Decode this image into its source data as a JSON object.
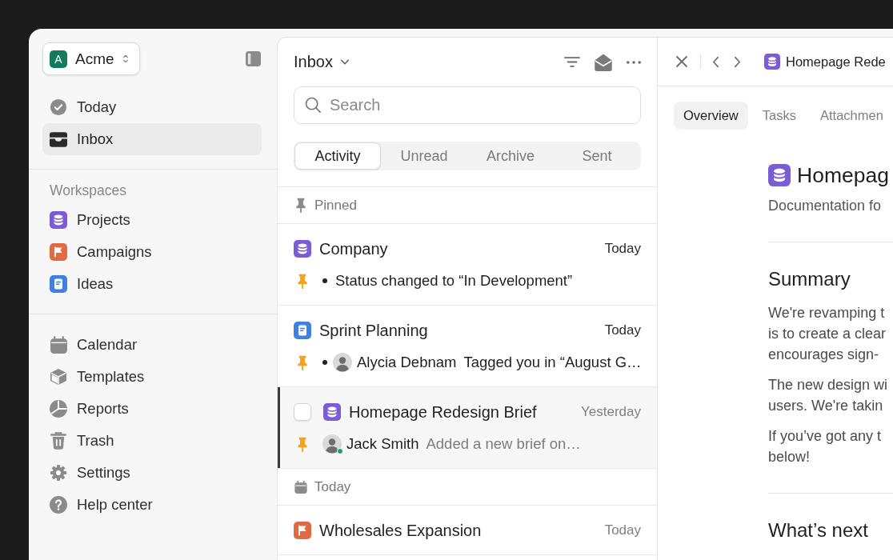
{
  "sidebar": {
    "workspace": {
      "initial": "A",
      "name": "Acme"
    },
    "nav": [
      {
        "kind": "check",
        "label": "Today",
        "selected": false
      },
      {
        "kind": "inbox",
        "label": "Inbox",
        "selected": true
      }
    ],
    "workspaces": {
      "heading": "Workspaces",
      "items": [
        {
          "kind": "database",
          "label": "Projects",
          "color": "#7b5cd6",
          "selected": false
        },
        {
          "kind": "flag",
          "label": "Campaigns",
          "color": "#e06a43",
          "selected": false
        },
        {
          "kind": "doc",
          "label": "Ideas",
          "color": "#3f80e0",
          "selected": false
        }
      ]
    },
    "links": [
      {
        "kind": "calendar",
        "label": "Calendar",
        "selected": false
      },
      {
        "kind": "box",
        "label": "Templates",
        "selected": false
      },
      {
        "kind": "pie",
        "label": "Reports",
        "selected": false
      },
      {
        "kind": "trash",
        "label": "Trash",
        "selected": false
      },
      {
        "kind": "gear",
        "label": "Settings",
        "selected": false
      },
      {
        "kind": "help",
        "label": "Help center",
        "selected": false
      }
    ]
  },
  "inbox": {
    "title": "Inbox",
    "search": {
      "placeholder": "Search"
    },
    "tabs": [
      {
        "label": "Activity",
        "selected": true
      },
      {
        "label": "Unread",
        "selected": false
      },
      {
        "label": "Archive",
        "selected": false
      },
      {
        "label": "Sent",
        "selected": false
      }
    ],
    "sections": [
      {
        "kind": "pinned",
        "label": "Pinned",
        "items": [
          {
            "kind": "database",
            "color": "#7b5cd6",
            "title": "Company",
            "date": "Today",
            "selected": false,
            "unread": true,
            "pinned": true,
            "text": "Status changed to “In Development”"
          },
          {
            "kind": "doc",
            "color": "#3f80e0",
            "title": "Sprint Planning",
            "date": "Today",
            "selected": false,
            "unread": true,
            "pinned": true,
            "actor": {
              "name": "Alycia Debnam",
              "online": false
            },
            "text": "Tagged you in “August G…"
          },
          {
            "kind": "database",
            "color": "#7b5cd6",
            "title": "Homepage Redesign Brief",
            "date": "Yesterday",
            "selected": true,
            "checked": false,
            "unread": false,
            "pinned": true,
            "actor": {
              "name": "Jack Smith",
              "online": true
            },
            "text": "Added a new brief on…"
          }
        ]
      },
      {
        "kind": "date",
        "label": "Today",
        "items": [
          {
            "kind": "flag",
            "color": "#e06a43",
            "title": "Wholesales Expansion",
            "date": "Today",
            "selected": false,
            "unread": false
          }
        ]
      }
    ]
  },
  "detail": {
    "breadcrumb": {
      "kind": "database",
      "title": "Homepage Rede"
    },
    "tabs": [
      {
        "label": "Overview",
        "selected": true
      },
      {
        "label": "Tasks",
        "selected": false
      },
      {
        "label": "Attachmen",
        "selected": false
      }
    ],
    "title": {
      "kind": "database",
      "text": "Homepag"
    },
    "subtitle": "Documentation fo",
    "sections": [
      {
        "heading": "Summary",
        "paragraphs": [
          {
            "lines": [
              "We're revamping t",
              "is to create a clear",
              "encourages sign-"
            ]
          },
          {
            "lines": [
              "The new design wi",
              "users. We're takin"
            ]
          },
          {
            "lines": [
              "If you’ve got any t",
              "below!"
            ]
          }
        ]
      },
      {
        "heading": "What’s next"
      }
    ]
  }
}
